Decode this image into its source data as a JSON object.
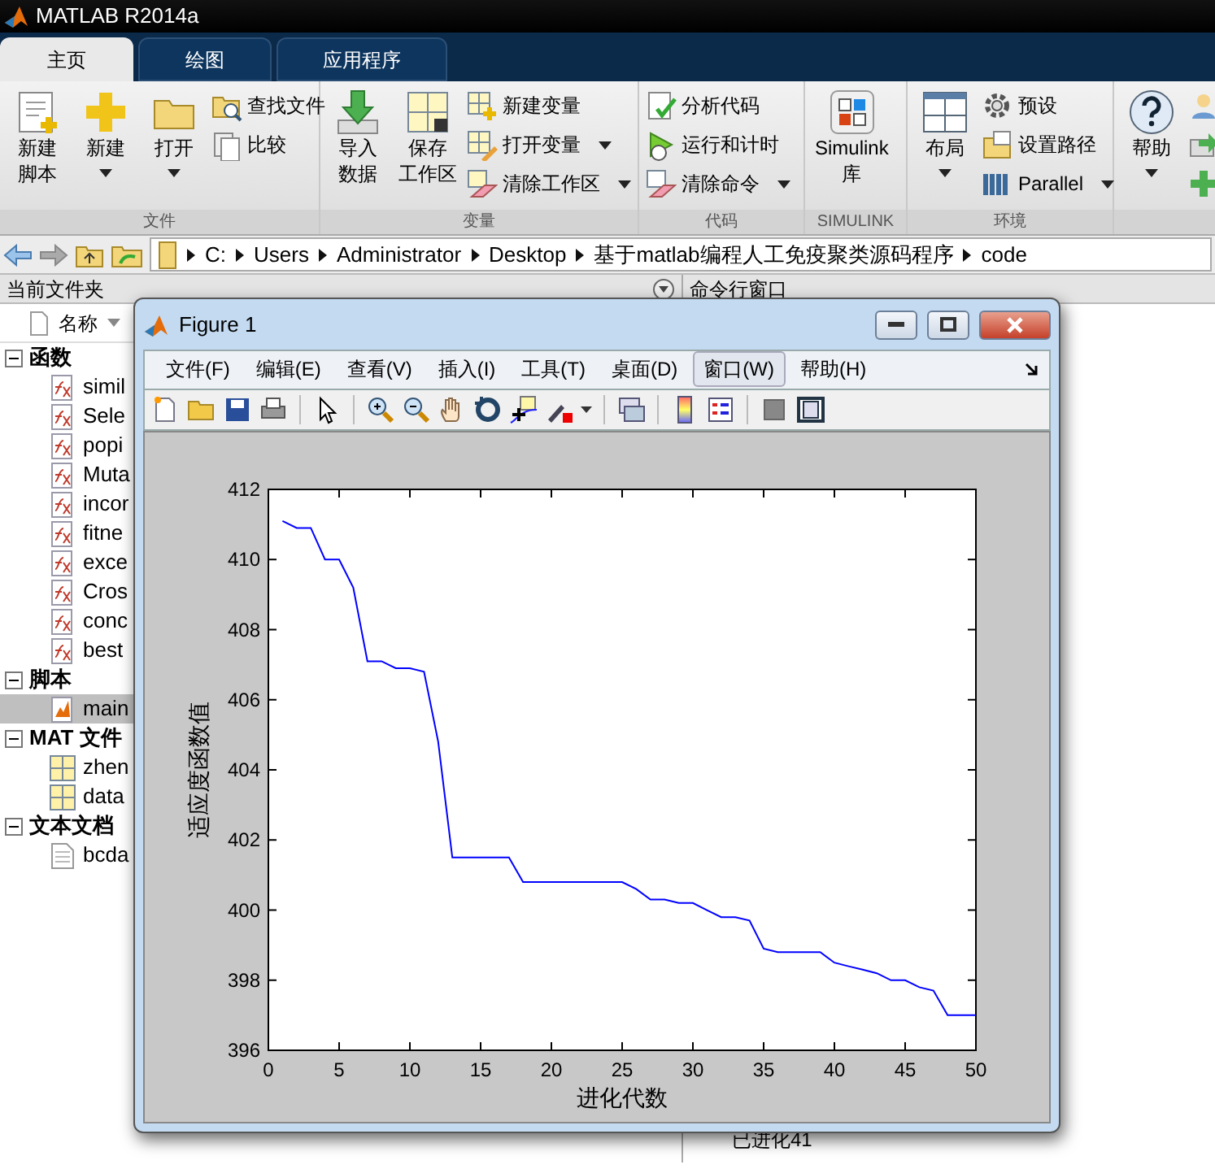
{
  "window": {
    "title": "MATLAB R2014a"
  },
  "tabs": [
    {
      "label": "主页",
      "selected": true
    },
    {
      "label": "绘图",
      "selected": false
    },
    {
      "label": "应用程序",
      "selected": false
    }
  ],
  "ribbon": {
    "groups": [
      {
        "label": "文件",
        "items": [
          {
            "kind": "large",
            "label_lines": [
              "新建",
              "脚本"
            ],
            "dropdown": false
          },
          {
            "kind": "large",
            "label": "新建",
            "dropdown": true
          },
          {
            "kind": "large",
            "label": "打开",
            "dropdown": true
          },
          {
            "kind": "small",
            "label": "查找文件",
            "dropdown": false
          },
          {
            "kind": "small",
            "label": "比较",
            "dropdown": false
          }
        ]
      },
      {
        "label": "变量",
        "items": [
          {
            "kind": "large",
            "label_lines": [
              "导入",
              "数据"
            ],
            "dropdown": false
          },
          {
            "kind": "large",
            "label_lines": [
              "保存",
              "工作区"
            ],
            "dropdown": false
          },
          {
            "kind": "small",
            "label": "新建变量",
            "dropdown": false
          },
          {
            "kind": "small",
            "label": "打开变量",
            "dropdown": true
          },
          {
            "kind": "small",
            "label": "清除工作区",
            "dropdown": true
          }
        ]
      },
      {
        "label": "代码",
        "items": [
          {
            "kind": "small",
            "label": "分析代码",
            "dropdown": false
          },
          {
            "kind": "small",
            "label": "运行和计时",
            "dropdown": false
          },
          {
            "kind": "small",
            "label": "清除命令",
            "dropdown": true
          }
        ]
      },
      {
        "label": "SIMULINK",
        "items": [
          {
            "kind": "large",
            "label_lines": [
              "Simulink",
              "库"
            ],
            "dropdown": false
          }
        ]
      },
      {
        "label": "环境",
        "items": [
          {
            "kind": "large",
            "label": "布局",
            "dropdown": true
          },
          {
            "kind": "small",
            "label": "预设",
            "dropdown": false
          },
          {
            "kind": "small",
            "label": "设置路径",
            "dropdown": false
          },
          {
            "kind": "small",
            "label": "Parallel",
            "dropdown": true
          }
        ]
      },
      {
        "items": [
          {
            "kind": "large",
            "label": "帮助",
            "dropdown": true
          },
          {
            "kind": "small",
            "dropdown": false
          },
          {
            "kind": "small",
            "dropdown": false
          },
          {
            "kind": "small",
            "dropdown": false
          }
        ]
      }
    ]
  },
  "address_bar": {
    "path": [
      "C:",
      "Users",
      "Administrator",
      "Desktop",
      "基于matlab编程人工免疫聚类源码程序",
      "code"
    ]
  },
  "file_panel": {
    "title": "当前文件夹",
    "column": "名称",
    "groups": [
      {
        "label": "函数",
        "expanded": true,
        "children": [
          {
            "name": "simil",
            "selected": false
          },
          {
            "name": "Sele",
            "selected": false
          },
          {
            "name": "popi",
            "selected": false
          },
          {
            "name": "Muta",
            "selected": false
          },
          {
            "name": "incor",
            "selected": false
          },
          {
            "name": "fitne",
            "selected": false
          },
          {
            "name": "exce",
            "selected": false
          },
          {
            "name": "Cros",
            "selected": false
          },
          {
            "name": "conc",
            "selected": false
          },
          {
            "name": "best",
            "selected": false
          }
        ]
      },
      {
        "label": "脚本",
        "expanded": true,
        "children": [
          {
            "name": "main",
            "selected": true
          }
        ]
      },
      {
        "label": "MAT 文件",
        "expanded": true,
        "children": [
          {
            "name": "zhen",
            "selected": false
          },
          {
            "name": "data",
            "selected": false
          }
        ]
      },
      {
        "label": "文本文档",
        "expanded": true,
        "children": [
          {
            "name": "bcda",
            "selected": false
          }
        ]
      }
    ]
  },
  "command_window": {
    "title": "命令行窗口",
    "lines": [
      "已进化41"
    ]
  },
  "figure": {
    "title": "Figure 1",
    "menu": [
      {
        "label": "文件(F)",
        "selected": false
      },
      {
        "label": "编辑(E)",
        "selected": false
      },
      {
        "label": "查看(V)",
        "selected": false
      },
      {
        "label": "插入(I)",
        "selected": false
      },
      {
        "label": "工具(T)",
        "selected": false
      },
      {
        "label": "桌面(D)",
        "selected": false
      },
      {
        "label": "窗口(W)",
        "selected": true
      },
      {
        "label": "帮助(H)",
        "selected": false
      }
    ],
    "chart_data": {
      "type": "line",
      "xlabel": "进化代数",
      "ylabel": "适应度函数值",
      "x": [
        1,
        2,
        3,
        4,
        5,
        6,
        7,
        8,
        9,
        10,
        11,
        12,
        13,
        14,
        15,
        16,
        17,
        18,
        19,
        20,
        21,
        22,
        23,
        24,
        25,
        26,
        27,
        28,
        29,
        30,
        31,
        32,
        33,
        34,
        35,
        36,
        37,
        38,
        39,
        40,
        41,
        42,
        43,
        44,
        45,
        46,
        47,
        48,
        49,
        50
      ],
      "series": [
        {
          "color": "#0000ff",
          "values": [
            411.1,
            410.9,
            410.9,
            410.0,
            410.0,
            409.2,
            407.1,
            407.1,
            406.9,
            406.9,
            406.8,
            404.8,
            401.5,
            401.5,
            401.5,
            401.5,
            401.5,
            400.8,
            400.8,
            400.8,
            400.8,
            400.8,
            400.8,
            400.8,
            400.8,
            400.6,
            400.3,
            400.3,
            400.2,
            400.2,
            400.0,
            399.8,
            399.8,
            399.7,
            398.9,
            398.8,
            398.8,
            398.8,
            398.8,
            398.5,
            398.4,
            398.3,
            398.2,
            398.0,
            398.0,
            397.8,
            397.7,
            397.0,
            397.0,
            397.0
          ]
        }
      ],
      "xlim": [
        0,
        50
      ],
      "ylim": [
        396,
        412
      ],
      "xticks": [
        0,
        5,
        10,
        15,
        20,
        25,
        30,
        35,
        40,
        45,
        50
      ],
      "yticks": [
        396,
        398,
        400,
        402,
        404,
        406,
        408,
        410,
        412
      ]
    }
  }
}
